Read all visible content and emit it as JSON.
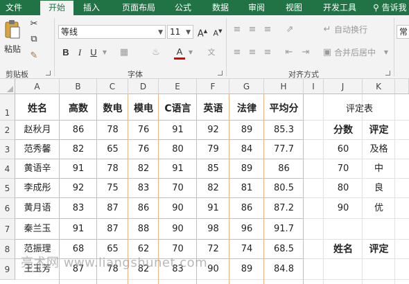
{
  "ribbon_tabs": [
    "文件",
    "开始",
    "插入",
    "页面布局",
    "公式",
    "数据",
    "审阅",
    "视图",
    "开发工具",
    "告诉我"
  ],
  "active_tab": "开始",
  "clipboard": {
    "paste_label": "粘贴",
    "group_label": "剪贴板"
  },
  "font": {
    "name": "等线",
    "size": "11",
    "group_label": "字体",
    "bold": "B",
    "italic": "I",
    "underline": "U",
    "grow": "A",
    "shrink": "A",
    "color_letter": "A"
  },
  "alignment": {
    "wrap_label": "自动换行",
    "merge_label": "合并后居中",
    "group_label": "对齐方式",
    "partial_label": "常规"
  },
  "columns": [
    "A",
    "B",
    "C",
    "D",
    "E",
    "F",
    "G",
    "H",
    "I",
    "J",
    "K"
  ],
  "rows": [
    "1",
    "2",
    "3",
    "4",
    "5",
    "6",
    "7",
    "8",
    "9"
  ],
  "headers": [
    "姓名",
    "高数",
    "数电",
    "模电",
    "C语言",
    "英语",
    "法律",
    "平均分"
  ],
  "students": [
    [
      "赵秋月",
      "86",
      "78",
      "76",
      "91",
      "92",
      "89",
      "85.3"
    ],
    [
      "范秀馨",
      "82",
      "65",
      "76",
      "80",
      "79",
      "84",
      "77.7"
    ],
    [
      "黄语辛",
      "91",
      "78",
      "82",
      "91",
      "85",
      "89",
      "86"
    ],
    [
      "李成彤",
      "92",
      "75",
      "83",
      "70",
      "82",
      "81",
      "80.5"
    ],
    [
      "黄月语",
      "83",
      "87",
      "86",
      "90",
      "91",
      "86",
      "87.2"
    ],
    [
      "秦兰玉",
      "91",
      "87",
      "88",
      "90",
      "98",
      "96",
      "91.7"
    ],
    [
      "范振理",
      "68",
      "65",
      "62",
      "70",
      "72",
      "74",
      "68.5"
    ],
    [
      "王玉芳",
      "87",
      "78",
      "82",
      "83",
      "90",
      "89",
      "84.8"
    ]
  ],
  "rating_table": {
    "title": "评定表",
    "head": [
      "分数",
      "评定"
    ],
    "rows": [
      [
        "60",
        "及格"
      ],
      [
        "70",
        "中"
      ],
      [
        "80",
        "良"
      ],
      [
        "90",
        "优"
      ]
    ],
    "lookup_head": [
      "姓名",
      "评定"
    ]
  },
  "watermark": "亮术网 www.liangshunet.com",
  "colors": {
    "excel_green": "#217346",
    "selection_border": "#f4b183",
    "font_color_bar": "#e00000"
  }
}
